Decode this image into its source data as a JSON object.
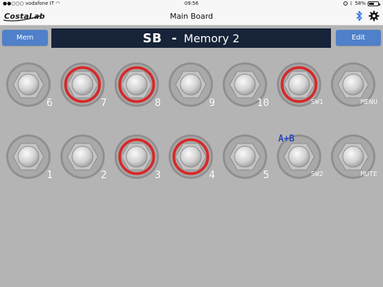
{
  "status": {
    "carrier": "vodafone IT",
    "time": "09:56",
    "battery": "58%",
    "battery_level": 0.58
  },
  "nav": {
    "logo": "CostaLab",
    "title": "Main Board"
  },
  "header": {
    "mem_label": "Mem",
    "bank": "SB",
    "separator": "-",
    "memory": "Memory 2",
    "edit_label": "Edit"
  },
  "colors": {
    "accent": "#4f80c9",
    "display_bg": "#162338",
    "ring_active": "#d62a2a",
    "ab_label": "#2c49b7"
  },
  "row1": [
    {
      "label": "6",
      "active": false
    },
    {
      "label": "7",
      "active": true
    },
    {
      "label": "8",
      "active": true
    },
    {
      "label": "9",
      "active": false
    },
    {
      "label": "10",
      "active": false
    },
    {
      "label": "SW1",
      "active": true
    },
    {
      "label": "MENU",
      "active": false
    }
  ],
  "row2": [
    {
      "label": "1",
      "active": false
    },
    {
      "label": "2",
      "active": false
    },
    {
      "label": "3",
      "active": true
    },
    {
      "label": "4",
      "active": true
    },
    {
      "label": "5",
      "active": false
    },
    {
      "label": "SW2",
      "active": false
    },
    {
      "label": "MUTE",
      "active": false
    }
  ],
  "sw2_mode": "A+B"
}
